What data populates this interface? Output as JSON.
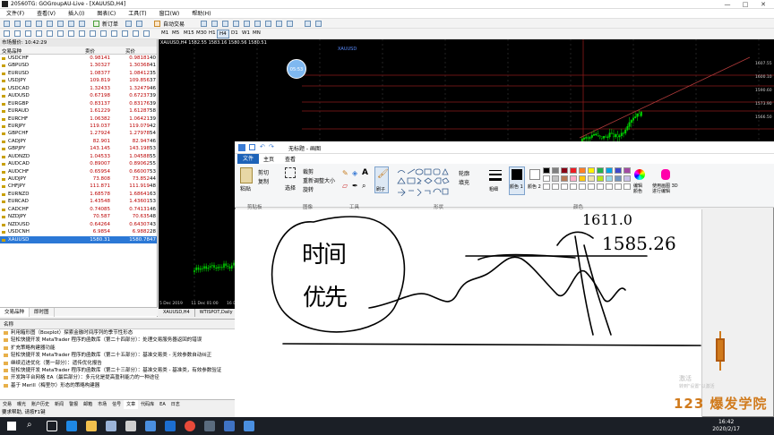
{
  "window": {
    "title": "20560TG: GOGroupAU-Live - [XAUUSD,H4]"
  },
  "menu": [
    "文件(F)",
    "查看(V)",
    "插入(I)",
    "图表(C)",
    "工具(T)",
    "窗口(W)",
    "帮助(H)"
  ],
  "toolbar": {
    "new_order": "新订单",
    "autotrade": "自动交易"
  },
  "timeframes": [
    "M1",
    "M5",
    "M15",
    "M30",
    "H1",
    "H4",
    "D1",
    "W1",
    "MN"
  ],
  "market_watch": {
    "header": "市场报价: 10:42:29",
    "col_symbol": "交易品种",
    "col_bid": "卖价",
    "col_ask": "买价",
    "rows": [
      {
        "s": "USDCHF",
        "b": "0.98141",
        "a": "0.98181",
        "sp": "40"
      },
      {
        "s": "GBPUSD",
        "b": "1.30327",
        "a": "1.30368",
        "sp": "41"
      },
      {
        "s": "EURUSD",
        "b": "1.08377",
        "a": "1.08412",
        "sp": "35"
      },
      {
        "s": "USDJPY",
        "b": "109.819",
        "a": "109.856",
        "sp": "37"
      },
      {
        "s": "USDCAD",
        "b": "1.32433",
        "a": "1.32479",
        "sp": "46"
      },
      {
        "s": "AUDUSD",
        "b": "0.67198",
        "a": "0.67237",
        "sp": "39"
      },
      {
        "s": "EURGBP",
        "b": "0.83137",
        "a": "0.83176",
        "sp": "39"
      },
      {
        "s": "EURAUD",
        "b": "1.61229",
        "a": "1.61287",
        "sp": "58"
      },
      {
        "s": "EURCHF",
        "b": "1.06382",
        "a": "1.06421",
        "sp": "39"
      },
      {
        "s": "EURJPY",
        "b": "119.037",
        "a": "119.079",
        "sp": "42"
      },
      {
        "s": "GBPCHF",
        "b": "1.27924",
        "a": "1.27978",
        "sp": "54"
      },
      {
        "s": "CADJPY",
        "b": "82.901",
        "a": "82.947",
        "sp": "46"
      },
      {
        "s": "GBPJPY",
        "b": "143.145",
        "a": "143.198",
        "sp": "53"
      },
      {
        "s": "AUDNZD",
        "b": "1.04533",
        "a": "1.04588",
        "sp": "55"
      },
      {
        "s": "AUDCAD",
        "b": "0.89007",
        "a": "0.89062",
        "sp": "55"
      },
      {
        "s": "AUDCHF",
        "b": "0.65954",
        "a": "0.66007",
        "sp": "53"
      },
      {
        "s": "AUDJPY",
        "b": "73.808",
        "a": "73.852",
        "sp": "44"
      },
      {
        "s": "CHFJPY",
        "b": "111.871",
        "a": "111.919",
        "sp": "48"
      },
      {
        "s": "EURNZD",
        "b": "1.68578",
        "a": "1.68641",
        "sp": "63"
      },
      {
        "s": "EURCAD",
        "b": "1.43548",
        "a": "1.43601",
        "sp": "53"
      },
      {
        "s": "CADCHF",
        "b": "0.74085",
        "a": "0.74131",
        "sp": "46"
      },
      {
        "s": "NZDJPY",
        "b": "70.587",
        "a": "70.635",
        "sp": "48"
      },
      {
        "s": "NZDUSD",
        "b": "0.64264",
        "a": "0.64307",
        "sp": "43"
      },
      {
        "s": "USDCNH",
        "b": "6.9854",
        "a": "6.9882",
        "sp": "28"
      },
      {
        "s": "XAUUSD",
        "b": "1580.31",
        "a": "1580.78",
        "sp": "47"
      }
    ],
    "tabs": [
      "交易品种",
      "即时图"
    ]
  },
  "chart": {
    "title": "XAUUSD,H4 1582.55 1583.16 1580.56 1580.51",
    "ticker": "XAUUSD",
    "price_labels": [
      "1607.55",
      "1600.10",
      "1590.60",
      "1573.90",
      "1566.50"
    ],
    "date_labels": [
      "5 Dec 2019",
      "11 Dec 01:00",
      "16 Dec 2019"
    ],
    "tabs": [
      "XAUUSD,H4",
      "WTISPOT,Daily"
    ],
    "badge": "05:53"
  },
  "toolbox": {
    "caption": "名称",
    "items": [
      "利用箱形图（Boxplot）探索金融时间序列的季节性形态",
      "轻松快捷开发 MetaTrader 程序的函数库（第二十四部分）：处理交易服务器返回的错误",
      "扩充策略构建器功能",
      "轻松快捷开发 MetaTrader 程序的函数库（第二十五部分）：基准交易类 - 无效参数自动纠正",
      "继续迈进优化（第一部分）：遗传优化报告",
      "轻松快捷开发 MetaTrader 程序的函数库（第二十三部分）：基准交易类 - 基准类，有效参数验证",
      "开发跨平台网格 EA（最后部分）：多元化是提高盈利能力的一种途径",
      "基于 Merill（梅里尔）形态的策略构建器"
    ],
    "tabs": [
      "交易",
      "曝光",
      "账户历史",
      "新闻",
      "警报",
      "邮箱",
      "市场",
      "信号",
      "文章",
      "代码库",
      "EA",
      "日志"
    ]
  },
  "status": "要求帮助, 请按F1键",
  "paint": {
    "title": "无标题 - 画图",
    "tabs": [
      "文件",
      "主页",
      "查看"
    ],
    "groups": {
      "clipboard": "剪贴板",
      "image": "图像",
      "tools": "工具",
      "shapes": "形状",
      "colors": "颜色"
    },
    "buttons": {
      "paste": "粘贴",
      "cut": "剪切",
      "copy": "复制",
      "select": "选择",
      "crop": "裁剪",
      "resize": "重新调整大小",
      "rotate": "旋转",
      "brush": "刷子",
      "outline": "轮廓",
      "fill": "填充",
      "size": "粗细",
      "color1": "颜色 1",
      "color2": "颜色 2",
      "edit_colors": "编辑颜色",
      "paint3d": "使用画图 3D 进行编辑"
    },
    "handwriting": {
      "left_top": "时间",
      "left_bottom": "优先",
      "num1": "1611.0",
      "num2": "1585.26"
    }
  },
  "taskbar": {
    "time": "16:42",
    "date": "2020/2/17"
  },
  "watermark": {
    "line1": "激活",
    "line2": "转到\"设置\"以激活",
    "logo": "123 爆发学院"
  },
  "colors": {
    "bull": "#00d000",
    "accent": "#1e63b8",
    "select": "#2b78d6",
    "red": "#b00000"
  }
}
